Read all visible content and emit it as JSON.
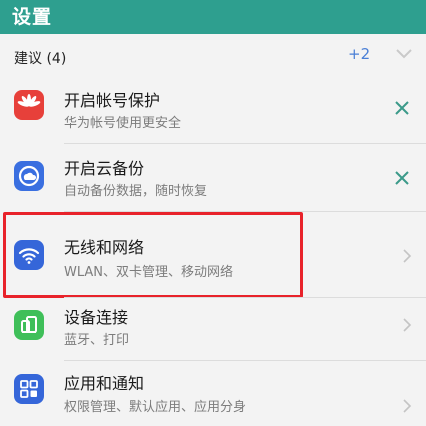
{
  "header": {
    "title": "设置"
  },
  "suggestions": {
    "label": "建议 (4)",
    "count": "+2"
  },
  "items": [
    {
      "title": "开启帐号保护",
      "subtitle": "华为帐号使用更安全",
      "icon": "huawei-logo-icon",
      "action": "close-icon",
      "color": "#e7403a"
    },
    {
      "title": "开启云备份",
      "subtitle": "自动备份数据，随时恢复",
      "icon": "cloud-backup-icon",
      "action": "close-icon",
      "color": "#3a6fe0"
    },
    {
      "title": "无线和网络",
      "subtitle": "WLAN、双卡管理、移动网络",
      "icon": "wifi-icon",
      "action": "chevron-right-icon",
      "color": "#3566d9"
    },
    {
      "title": "设备连接",
      "subtitle": "蓝牙、打印",
      "icon": "device-connect-icon",
      "action": "chevron-right-icon",
      "color": "#3fbf59"
    },
    {
      "title": "应用和通知",
      "subtitle": "权限管理、默认应用、应用分身",
      "icon": "apps-grid-icon",
      "action": "chevron-right-icon",
      "color": "#3566d9"
    }
  ]
}
